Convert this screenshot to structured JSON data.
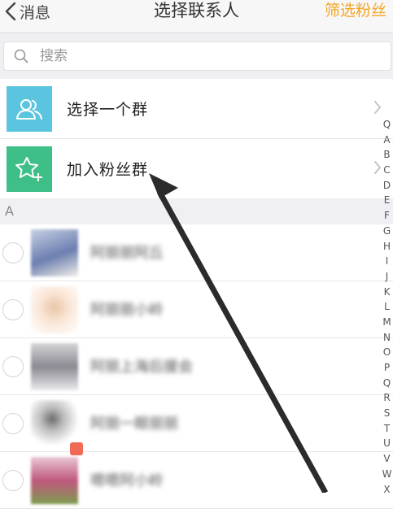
{
  "header": {
    "back_label": "消息",
    "title": "选择联系人",
    "filter_label": "筛选粉丝"
  },
  "search": {
    "placeholder": "搜索"
  },
  "groups": [
    {
      "label": "选择一个群",
      "icon": "group-icon"
    },
    {
      "label": "加入粉丝群",
      "icon": "star-add-icon"
    }
  ],
  "section": {
    "letter": "A"
  },
  "contacts": [
    {
      "name": "阿丽丽阿丘",
      "avatar_colors": [
        "#c8d0e4",
        "#6b7fb0",
        "#f2efe8"
      ]
    },
    {
      "name": "阿丽丽小岭",
      "avatar_colors": [
        "#fbe7d8",
        "#e8c6a8",
        "#ffffff"
      ]
    },
    {
      "name": "阿丽上海后援会",
      "avatar_colors": [
        "#d4d4d8",
        "#8b8a92",
        "#e9e9ee"
      ]
    },
    {
      "name": "阿丽一眼丽丽",
      "avatar_colors": [
        "#ffffff",
        "#6c6c6c",
        "#f0f0f0"
      ]
    },
    {
      "name": "嗯嗯阿小岭",
      "avatar_colors": [
        "#e8c7d6",
        "#c0577e",
        "#7e9c4e"
      ]
    }
  ],
  "index": [
    "Q",
    "A",
    "B",
    "C",
    "D",
    "E",
    "F",
    "G",
    "H",
    "I",
    "J",
    "K",
    "L",
    "M",
    "N",
    "O",
    "P",
    "Q",
    "R",
    "S",
    "T",
    "U",
    "V",
    "W",
    "X"
  ],
  "colors": {
    "accent": "#f5a623",
    "group_blue": "#5bc5df",
    "group_green": "#3dbf87",
    "arrow": "#2b2b2b"
  }
}
